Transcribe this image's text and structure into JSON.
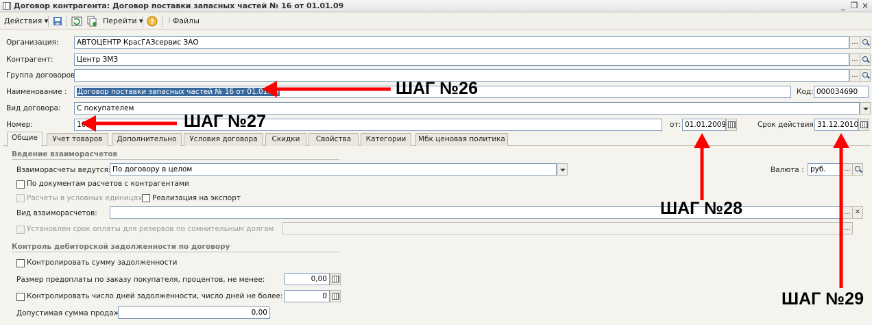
{
  "window": {
    "title": "Договор контрагента: Договор поставки запасных частей № 16 от 01.01.09",
    "minimize_glyph": "_",
    "restore_glyph": "❐",
    "close_glyph": "×"
  },
  "toolbar": {
    "actions_label": "Действия",
    "goto_label": "Перейти",
    "help_glyph": "?",
    "files_label": "Файлы"
  },
  "form": {
    "organization": {
      "label": "Организация:",
      "value": "АВТОЦЕНТР КрасГАЗсервис ЗАО"
    },
    "counterparty": {
      "label": "Контрагент:",
      "value": "Центр ЗМЗ"
    },
    "contract_group": {
      "label": "Группа договоров:",
      "value": ""
    },
    "name": {
      "label": "Наименование :",
      "value": "Договор поставки запасных частей № 16 от 01.01.09"
    },
    "code": {
      "label": "Код:",
      "value": "000034690"
    },
    "contract_type": {
      "label": "Вид договора:",
      "value": "С покупателем"
    },
    "number": {
      "label": "Номер:",
      "value": "16"
    },
    "date_from": {
      "label": "от:",
      "value": "01.01.2009"
    },
    "valid_until": {
      "label": "Срок действия:",
      "value": "31.12.2010"
    },
    "select_glyph": "..."
  },
  "tabs": [
    {
      "label": "Общие",
      "active": true
    },
    {
      "label": "Учет товаров"
    },
    {
      "label": "Дополнительно"
    },
    {
      "label": "Условия договора"
    },
    {
      "label": "Скидки"
    },
    {
      "label": "Свойства"
    },
    {
      "label": "Категории"
    },
    {
      "label": "Мбк ценовая политика"
    }
  ],
  "general": {
    "settlements_group": "Ведение взаиморасчетов",
    "settlements_label": "Взаиморасчеты ведутся:",
    "settlements_value": "По договору в целом",
    "currency_label": "Валюта :",
    "currency_value": "руб.",
    "by_docs_label": "По документам расчетов с контрагентами",
    "conventional_units_label": "Расчеты в условных единицах",
    "export_label": "Реализация на экспорт",
    "settlement_kind_label": "Вид взаиморасчетов:",
    "settlement_kind_value": "",
    "reserve_term_label": "Установлен срок оплаты для резервов по сомнительным долгам",
    "debt_group": "Контроль дебиторской задолженности по договору",
    "control_sum_label": "Контролировать сумму задолженности",
    "prepay_label": "Размер предоплаты по заказу покупателя, процентов, не менее:",
    "prepay_value": "0,00",
    "control_days_label": "Контролировать число дней задолженности, число дней не более:",
    "control_days_value": "0",
    "allowed_sum_label": "Допустимая сумма продаж:",
    "allowed_sum_value": "0,00",
    "clear_glyph": "✕"
  },
  "annotations": {
    "step26": "ШАГ №26",
    "step27": "ШАГ №27",
    "step28": "ШАГ №28",
    "step29": "ШАГ №29",
    "arrow_color": "#ff0000"
  }
}
